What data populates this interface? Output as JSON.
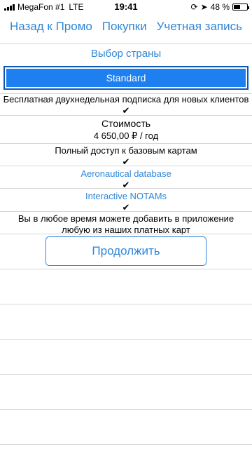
{
  "status_bar": {
    "carrier": "MegaFon #1",
    "network": "LTE",
    "time": "19:41",
    "battery_percent": "48 %",
    "battery_level": 0.48
  },
  "nav": {
    "back_label": "Назад к Промо",
    "purchases_label": "Покупки",
    "account_label": "Учетная запись"
  },
  "country_select_label": "Выбор страны",
  "plan_button_label": "Standard",
  "features": {
    "trial": "Бесплатная двухнедельная подписка для новых клиентов",
    "cost_title": "Стоимость",
    "cost_value": "4 650,00 ₽ / год",
    "base_maps": "Полный доступ к базовым картам",
    "aeronautical": "Aeronautical database",
    "notams": "Interactive NOTAMs",
    "add_maps_line1": "Вы в любое время можете добавить в приложение",
    "add_maps_line2": "любую из наших платных карт",
    "check_mark": "✔"
  },
  "continue_label": "Продолжить",
  "colors": {
    "accent": "#2f86d6",
    "plan_button": "#1e7ff0",
    "plan_border": "#0b57b8"
  }
}
